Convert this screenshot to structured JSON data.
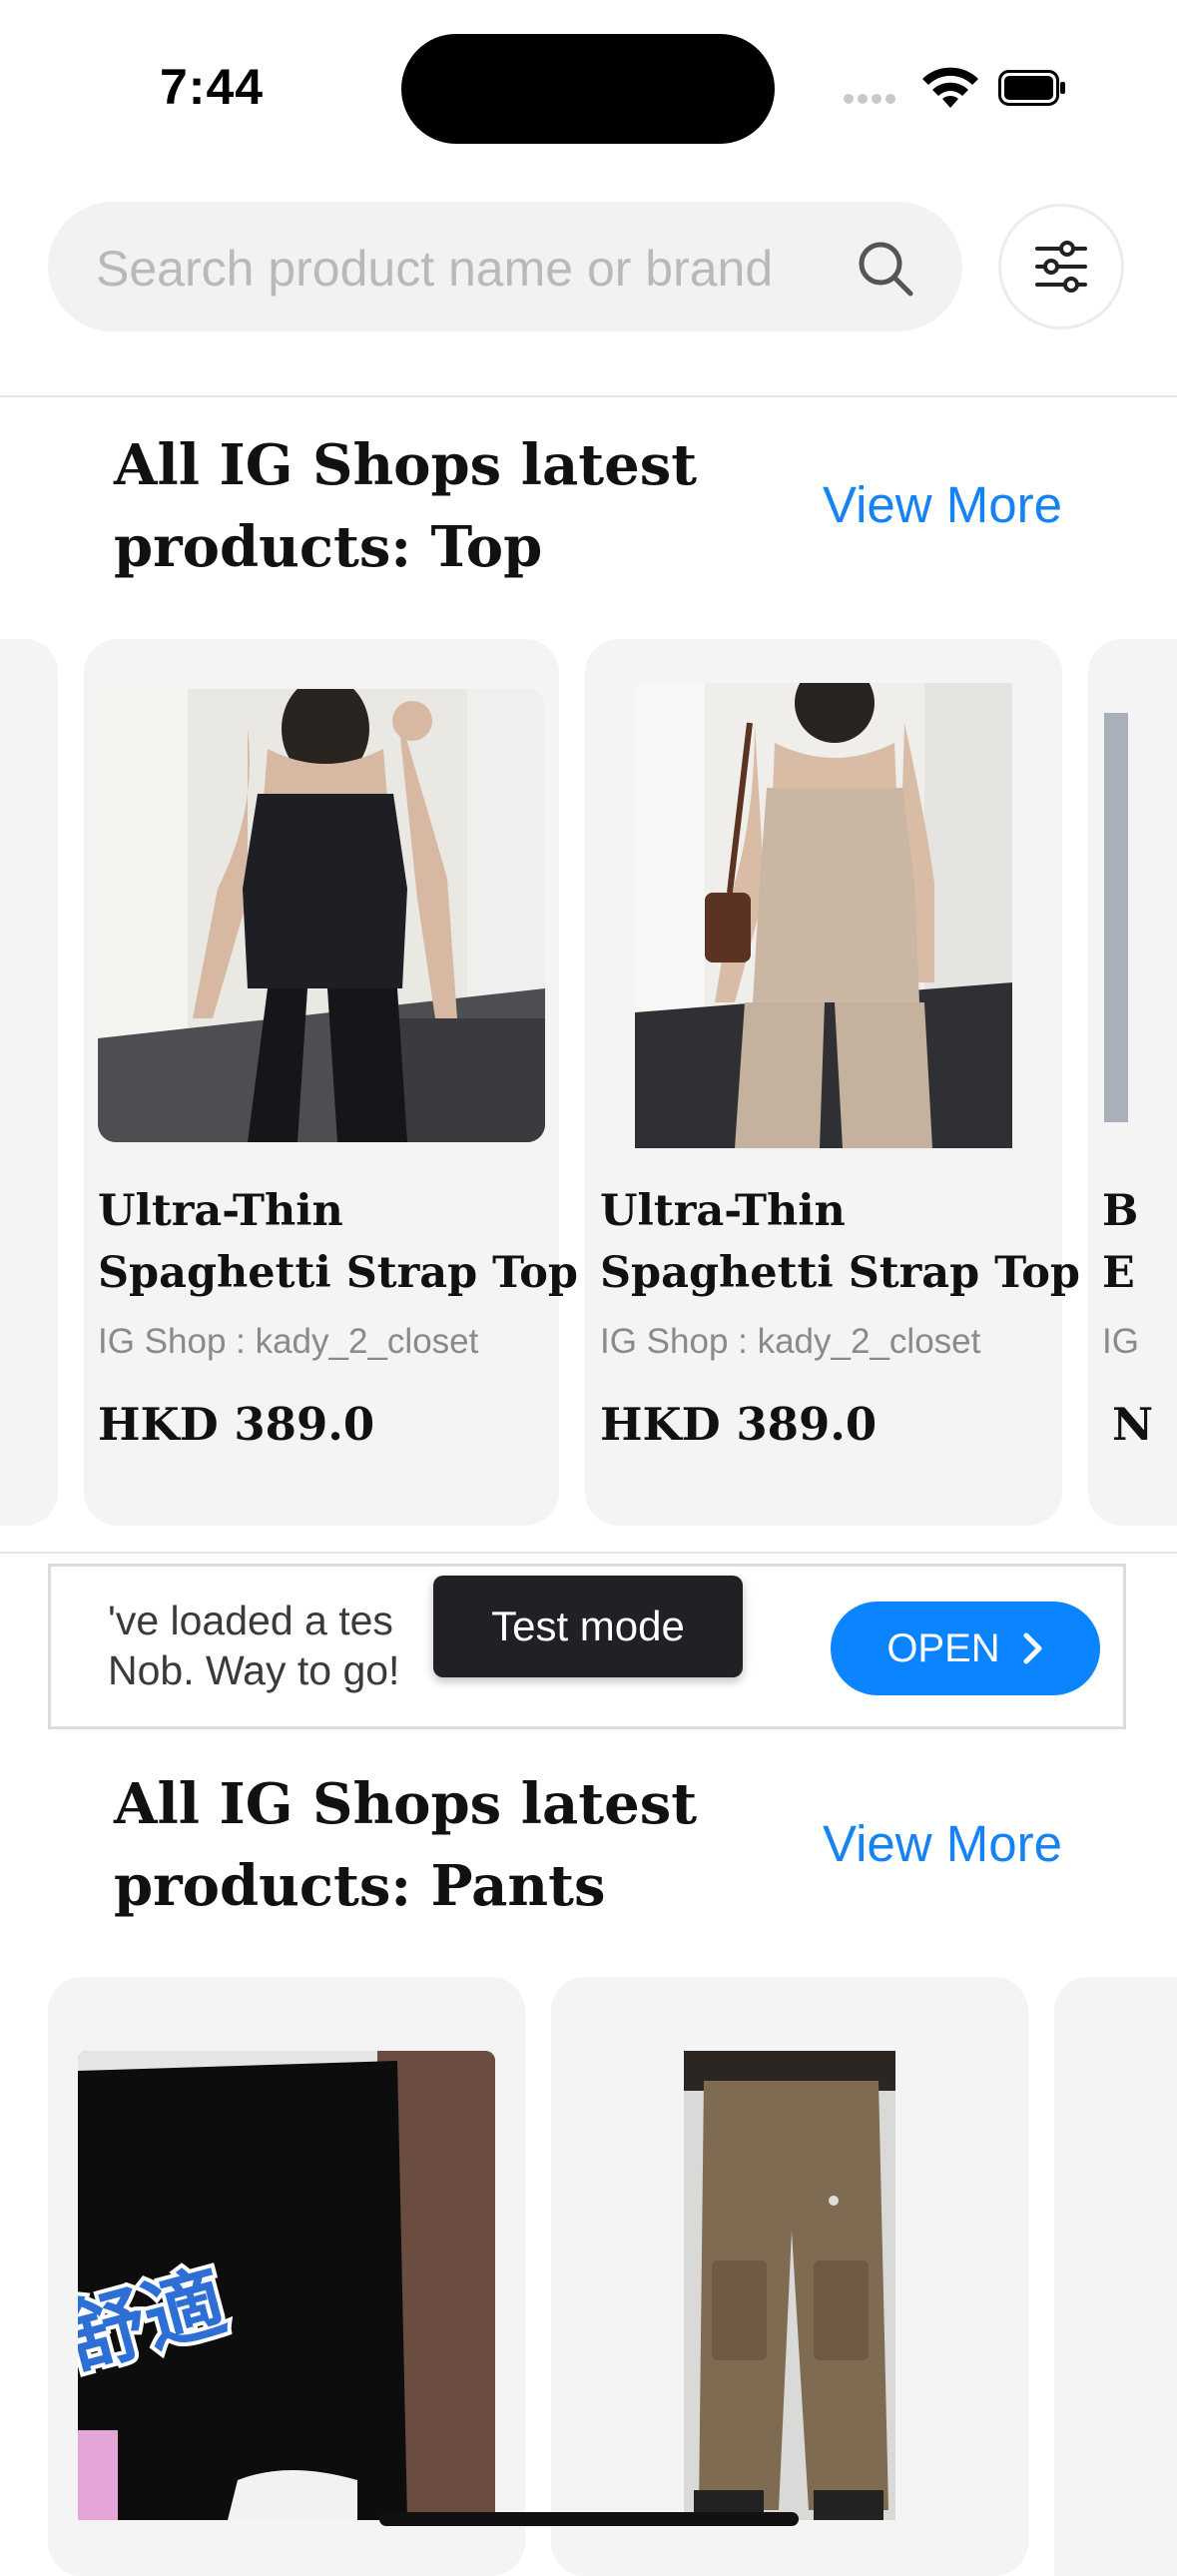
{
  "status_bar": {
    "time": "7:44"
  },
  "search": {
    "placeholder": "Search product name or brand"
  },
  "sections": [
    {
      "title": "All IG Shops latest products: Top",
      "view_more": "View More",
      "products": [
        {
          "name_line1": "Ultra-Thin",
          "name_line2": "Spaghetti Strap Top",
          "shop": "IG Shop : kady_2_closet",
          "price": "HKD 389.0"
        },
        {
          "name_line1": "Ultra-Thin",
          "name_line2": "Spaghetti Strap Top",
          "shop": "IG Shop : kady_2_closet",
          "price": "HKD 389.0"
        },
        {
          "name_line1": "B",
          "name_line2": "E",
          "shop": "IG",
          "price": "N"
        }
      ]
    },
    {
      "title": "All IG Shops latest products: Pants",
      "view_more": "View More",
      "image_overlay_text": "舒適"
    }
  ],
  "ad": {
    "line1": "'ve loaded a tes",
    "line2": "Nob. Way to go!",
    "badge": "Test mode",
    "button": "OPEN"
  },
  "colors": {
    "accent": "#1583f4",
    "open_button": "#0a84ff",
    "card_bg": "#f4f4f4"
  }
}
